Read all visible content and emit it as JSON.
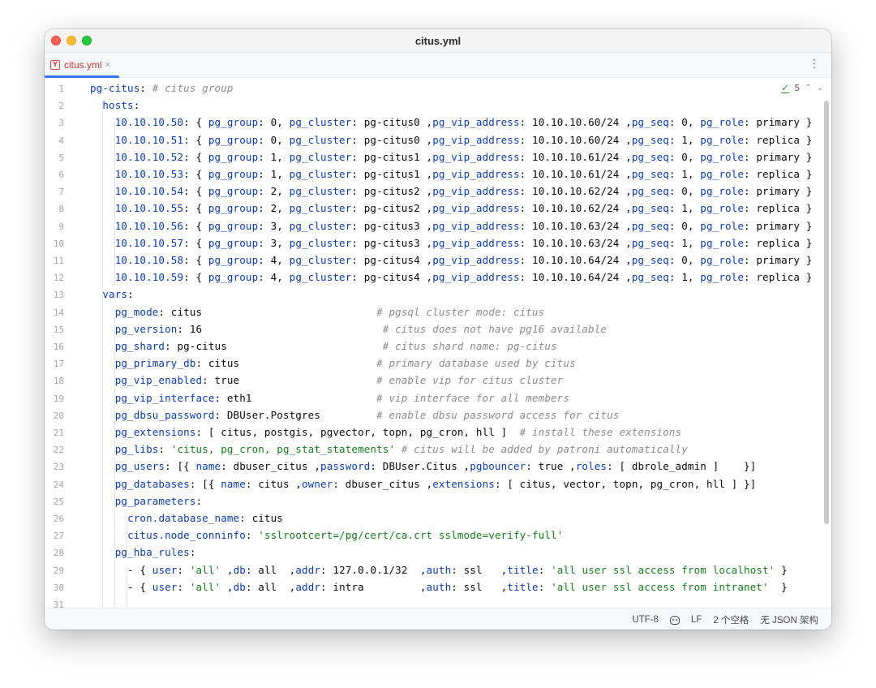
{
  "window": {
    "title": "citus.yml"
  },
  "tab": {
    "label": "citus.yml",
    "close": "×",
    "menu": "⋮"
  },
  "inspection": {
    "count": "5",
    "up": "⌃",
    "down": "⌄"
  },
  "status": {
    "encoding": "UTF-8",
    "line_ending": "LF",
    "indent": "2 个空格",
    "schema": "无 JSON 架构"
  },
  "editor": {
    "line_numbers": [
      "1",
      "2",
      "3",
      "4",
      "5",
      "6",
      "7",
      "8",
      "9",
      "10",
      "11",
      "12",
      "13",
      "14",
      "15",
      "16",
      "17",
      "18",
      "19",
      "20",
      "21",
      "22",
      "23",
      "24",
      "25",
      "26",
      "27",
      "28",
      "29",
      "30",
      "31"
    ],
    "lines": [
      [
        {
          "t": "pg-citus",
          "k": "k"
        },
        {
          "t": ": "
        },
        {
          "t": "# citus group",
          "k": "c"
        }
      ],
      [
        {
          "t": "  "
        },
        {
          "t": "hosts",
          "k": "k"
        },
        {
          "t": ":"
        }
      ],
      [
        {
          "t": "    "
        },
        {
          "t": "10.10.10.50",
          "k": "k"
        },
        {
          "t": ": { "
        },
        {
          "t": "pg_group",
          "k": "k"
        },
        {
          "t": ": 0, "
        },
        {
          "t": "pg_cluster",
          "k": "k"
        },
        {
          "t": ": pg-citus0 ,"
        },
        {
          "t": "pg_vip_address",
          "k": "k"
        },
        {
          "t": ": 10.10.10.60/24 ,"
        },
        {
          "t": "pg_seq",
          "k": "k"
        },
        {
          "t": ": 0, "
        },
        {
          "t": "pg_role",
          "k": "k"
        },
        {
          "t": ": primary }"
        }
      ],
      [
        {
          "t": "    "
        },
        {
          "t": "10.10.10.51",
          "k": "k"
        },
        {
          "t": ": { "
        },
        {
          "t": "pg_group",
          "k": "k"
        },
        {
          "t": ": 0, "
        },
        {
          "t": "pg_cluster",
          "k": "k"
        },
        {
          "t": ": pg-citus0 ,"
        },
        {
          "t": "pg_vip_address",
          "k": "k"
        },
        {
          "t": ": 10.10.10.60/24 ,"
        },
        {
          "t": "pg_seq",
          "k": "k"
        },
        {
          "t": ": 1, "
        },
        {
          "t": "pg_role",
          "k": "k"
        },
        {
          "t": ": replica }"
        }
      ],
      [
        {
          "t": "    "
        },
        {
          "t": "10.10.10.52",
          "k": "k"
        },
        {
          "t": ": { "
        },
        {
          "t": "pg_group",
          "k": "k"
        },
        {
          "t": ": 1, "
        },
        {
          "t": "pg_cluster",
          "k": "k"
        },
        {
          "t": ": pg-citus1 ,"
        },
        {
          "t": "pg_vip_address",
          "k": "k"
        },
        {
          "t": ": 10.10.10.61/24 ,"
        },
        {
          "t": "pg_seq",
          "k": "k"
        },
        {
          "t": ": 0, "
        },
        {
          "t": "pg_role",
          "k": "k"
        },
        {
          "t": ": primary }"
        }
      ],
      [
        {
          "t": "    "
        },
        {
          "t": "10.10.10.53",
          "k": "k"
        },
        {
          "t": ": { "
        },
        {
          "t": "pg_group",
          "k": "k"
        },
        {
          "t": ": 1, "
        },
        {
          "t": "pg_cluster",
          "k": "k"
        },
        {
          "t": ": pg-citus1 ,"
        },
        {
          "t": "pg_vip_address",
          "k": "k"
        },
        {
          "t": ": 10.10.10.61/24 ,"
        },
        {
          "t": "pg_seq",
          "k": "k"
        },
        {
          "t": ": 1, "
        },
        {
          "t": "pg_role",
          "k": "k"
        },
        {
          "t": ": replica }"
        }
      ],
      [
        {
          "t": "    "
        },
        {
          "t": "10.10.10.54",
          "k": "k"
        },
        {
          "t": ": { "
        },
        {
          "t": "pg_group",
          "k": "k"
        },
        {
          "t": ": 2, "
        },
        {
          "t": "pg_cluster",
          "k": "k"
        },
        {
          "t": ": pg-citus2 ,"
        },
        {
          "t": "pg_vip_address",
          "k": "k"
        },
        {
          "t": ": 10.10.10.62/24 ,"
        },
        {
          "t": "pg_seq",
          "k": "k"
        },
        {
          "t": ": 0, "
        },
        {
          "t": "pg_role",
          "k": "k"
        },
        {
          "t": ": primary }"
        }
      ],
      [
        {
          "t": "    "
        },
        {
          "t": "10.10.10.55",
          "k": "k"
        },
        {
          "t": ": { "
        },
        {
          "t": "pg_group",
          "k": "k"
        },
        {
          "t": ": 2, "
        },
        {
          "t": "pg_cluster",
          "k": "k"
        },
        {
          "t": ": pg-citus2 ,"
        },
        {
          "t": "pg_vip_address",
          "k": "k"
        },
        {
          "t": ": 10.10.10.62/24 ,"
        },
        {
          "t": "pg_seq",
          "k": "k"
        },
        {
          "t": ": 1, "
        },
        {
          "t": "pg_role",
          "k": "k"
        },
        {
          "t": ": replica }"
        }
      ],
      [
        {
          "t": "    "
        },
        {
          "t": "10.10.10.56",
          "k": "k"
        },
        {
          "t": ": { "
        },
        {
          "t": "pg_group",
          "k": "k"
        },
        {
          "t": ": 3, "
        },
        {
          "t": "pg_cluster",
          "k": "k"
        },
        {
          "t": ": pg-citus3 ,"
        },
        {
          "t": "pg_vip_address",
          "k": "k"
        },
        {
          "t": ": 10.10.10.63/24 ,"
        },
        {
          "t": "pg_seq",
          "k": "k"
        },
        {
          "t": ": 0, "
        },
        {
          "t": "pg_role",
          "k": "k"
        },
        {
          "t": ": primary }"
        }
      ],
      [
        {
          "t": "    "
        },
        {
          "t": "10.10.10.57",
          "k": "k"
        },
        {
          "t": ": { "
        },
        {
          "t": "pg_group",
          "k": "k"
        },
        {
          "t": ": 3, "
        },
        {
          "t": "pg_cluster",
          "k": "k"
        },
        {
          "t": ": pg-citus3 ,"
        },
        {
          "t": "pg_vip_address",
          "k": "k"
        },
        {
          "t": ": 10.10.10.63/24 ,"
        },
        {
          "t": "pg_seq",
          "k": "k"
        },
        {
          "t": ": 1, "
        },
        {
          "t": "pg_role",
          "k": "k"
        },
        {
          "t": ": replica }"
        }
      ],
      [
        {
          "t": "    "
        },
        {
          "t": "10.10.10.58",
          "k": "k"
        },
        {
          "t": ": { "
        },
        {
          "t": "pg_group",
          "k": "k"
        },
        {
          "t": ": 4, "
        },
        {
          "t": "pg_cluster",
          "k": "k"
        },
        {
          "t": ": pg-citus4 ,"
        },
        {
          "t": "pg_vip_address",
          "k": "k"
        },
        {
          "t": ": 10.10.10.64/24 ,"
        },
        {
          "t": "pg_seq",
          "k": "k"
        },
        {
          "t": ": 0, "
        },
        {
          "t": "pg_role",
          "k": "k"
        },
        {
          "t": ": primary }"
        }
      ],
      [
        {
          "t": "    "
        },
        {
          "t": "10.10.10.59",
          "k": "k"
        },
        {
          "t": ": { "
        },
        {
          "t": "pg_group",
          "k": "k"
        },
        {
          "t": ": 4, "
        },
        {
          "t": "pg_cluster",
          "k": "k"
        },
        {
          "t": ": pg-citus4 ,"
        },
        {
          "t": "pg_vip_address",
          "k": "k"
        },
        {
          "t": ": 10.10.10.64/24 ,"
        },
        {
          "t": "pg_seq",
          "k": "k"
        },
        {
          "t": ": 1, "
        },
        {
          "t": "pg_role",
          "k": "k"
        },
        {
          "t": ": replica }"
        }
      ],
      [
        {
          "t": "  "
        },
        {
          "t": "vars",
          "k": "k"
        },
        {
          "t": ":"
        }
      ],
      [
        {
          "t": "    "
        },
        {
          "t": "pg_mode",
          "k": "k"
        },
        {
          "t": ": citus                            "
        },
        {
          "t": "# pgsql cluster mode: citus",
          "k": "c"
        }
      ],
      [
        {
          "t": "    "
        },
        {
          "t": "pg_version",
          "k": "k"
        },
        {
          "t": ": 16                             "
        },
        {
          "t": "# citus does not have pg16 available",
          "k": "c"
        }
      ],
      [
        {
          "t": "    "
        },
        {
          "t": "pg_shard",
          "k": "k"
        },
        {
          "t": ": pg-citus                         "
        },
        {
          "t": "# citus shard name: pg-citus",
          "k": "c"
        }
      ],
      [
        {
          "t": "    "
        },
        {
          "t": "pg_primary_db",
          "k": "k"
        },
        {
          "t": ": citus                      "
        },
        {
          "t": "# primary database used by citus",
          "k": "c"
        }
      ],
      [
        {
          "t": "    "
        },
        {
          "t": "pg_vip_enabled",
          "k": "k"
        },
        {
          "t": ": true                      "
        },
        {
          "t": "# enable vip for citus cluster",
          "k": "c"
        }
      ],
      [
        {
          "t": "    "
        },
        {
          "t": "pg_vip_interface",
          "k": "k"
        },
        {
          "t": ": eth1                    "
        },
        {
          "t": "# vip interface for all members",
          "k": "c"
        }
      ],
      [
        {
          "t": "    "
        },
        {
          "t": "pg_dbsu_password",
          "k": "k"
        },
        {
          "t": ": DBUser.Postgres         "
        },
        {
          "t": "# enable dbsu password access for citus",
          "k": "c"
        }
      ],
      [
        {
          "t": "    "
        },
        {
          "t": "pg_extensions",
          "k": "k"
        },
        {
          "t": ": [ citus, postgis, pgvector, topn, pg_cron, hll ]  "
        },
        {
          "t": "# install these extensions",
          "k": "c"
        }
      ],
      [
        {
          "t": "    "
        },
        {
          "t": "pg_libs",
          "k": "k"
        },
        {
          "t": ": "
        },
        {
          "t": "'citus, pg_cron, pg_stat_statements'",
          "k": "s"
        },
        {
          "t": " "
        },
        {
          "t": "# citus will be added by patroni automatically",
          "k": "c"
        }
      ],
      [
        {
          "t": "    "
        },
        {
          "t": "pg_users",
          "k": "k"
        },
        {
          "t": ": [{ "
        },
        {
          "t": "name",
          "k": "k"
        },
        {
          "t": ": dbuser_citus ,"
        },
        {
          "t": "password",
          "k": "k"
        },
        {
          "t": ": DBUser.Citus ,"
        },
        {
          "t": "pgbouncer",
          "k": "k"
        },
        {
          "t": ": true ,"
        },
        {
          "t": "roles",
          "k": "k"
        },
        {
          "t": ": [ dbrole_admin ]    }]"
        }
      ],
      [
        {
          "t": "    "
        },
        {
          "t": "pg_databases",
          "k": "k"
        },
        {
          "t": ": [{ "
        },
        {
          "t": "name",
          "k": "k"
        },
        {
          "t": ": citus ,"
        },
        {
          "t": "owner",
          "k": "k"
        },
        {
          "t": ": dbuser_citus ,"
        },
        {
          "t": "extensions",
          "k": "k"
        },
        {
          "t": ": [ citus, vector, topn, pg_cron, hll ] }]"
        }
      ],
      [
        {
          "t": "    "
        },
        {
          "t": "pg_parameters",
          "k": "k"
        },
        {
          "t": ":"
        }
      ],
      [
        {
          "t": "      "
        },
        {
          "t": "cron.database_name",
          "k": "k"
        },
        {
          "t": ": citus"
        }
      ],
      [
        {
          "t": "      "
        },
        {
          "t": "citus.node_conninfo",
          "k": "k"
        },
        {
          "t": ": "
        },
        {
          "t": "'sslrootcert=/pg/cert/ca.crt sslmode=verify-full'",
          "k": "s"
        }
      ],
      [
        {
          "t": "    "
        },
        {
          "t": "pg_hba_rules",
          "k": "k"
        },
        {
          "t": ":"
        }
      ],
      [
        {
          "t": "      - { "
        },
        {
          "t": "user",
          "k": "k"
        },
        {
          "t": ": "
        },
        {
          "t": "'all'",
          "k": "s"
        },
        {
          "t": " ,"
        },
        {
          "t": "db",
          "k": "k"
        },
        {
          "t": ": all  ,"
        },
        {
          "t": "addr",
          "k": "k"
        },
        {
          "t": ": 127.0.0.1/32  ,"
        },
        {
          "t": "auth",
          "k": "k"
        },
        {
          "t": ": ssl   ,"
        },
        {
          "t": "title",
          "k": "k"
        },
        {
          "t": ": "
        },
        {
          "t": "'all user ssl access from localhost'",
          "k": "s"
        },
        {
          "t": " }"
        }
      ],
      [
        {
          "t": "      - { "
        },
        {
          "t": "user",
          "k": "k"
        },
        {
          "t": ": "
        },
        {
          "t": "'all'",
          "k": "s"
        },
        {
          "t": " ,"
        },
        {
          "t": "db",
          "k": "k"
        },
        {
          "t": ": all  ,"
        },
        {
          "t": "addr",
          "k": "k"
        },
        {
          "t": ": intra         ,"
        },
        {
          "t": "auth",
          "k": "k"
        },
        {
          "t": ": ssl   ,"
        },
        {
          "t": "title",
          "k": "k"
        },
        {
          "t": ": "
        },
        {
          "t": "'all user ssl access from intranet'",
          "k": "s"
        },
        {
          "t": "  }"
        }
      ],
      [
        {
          "t": ""
        }
      ]
    ]
  }
}
